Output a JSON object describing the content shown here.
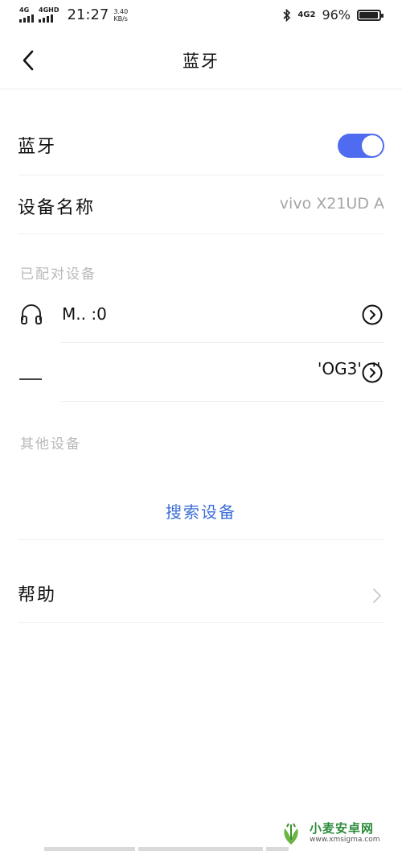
{
  "status_bar": {
    "net1": "4G",
    "net2": "4GHD",
    "time": "21:27",
    "speed_value": "3.40",
    "speed_unit": "KB/s",
    "net3": "4G2",
    "battery_pct": "96%",
    "battery_level": 0.96
  },
  "header": {
    "title": "蓝牙"
  },
  "bluetooth": {
    "label": "蓝牙",
    "enabled": true
  },
  "device_name": {
    "label": "设备名称",
    "value": "vivo X21UD A"
  },
  "paired_section": "已配对设备",
  "paired_devices": [
    {
      "icon": "headphones-icon",
      "name": "M..  :0"
    },
    {
      "icon": "device-icon",
      "name": "                                                  'OG3'  ''"
    }
  ],
  "other_section": "其他设备",
  "search_label": "搜索设备",
  "help_label": "帮助",
  "watermark": {
    "name": "小麦安卓网",
    "url": "www.xmsigma.com"
  },
  "colors": {
    "accent": "#4f6bf0",
    "link": "#3d6fd6",
    "muted": "#a5a5a5"
  }
}
